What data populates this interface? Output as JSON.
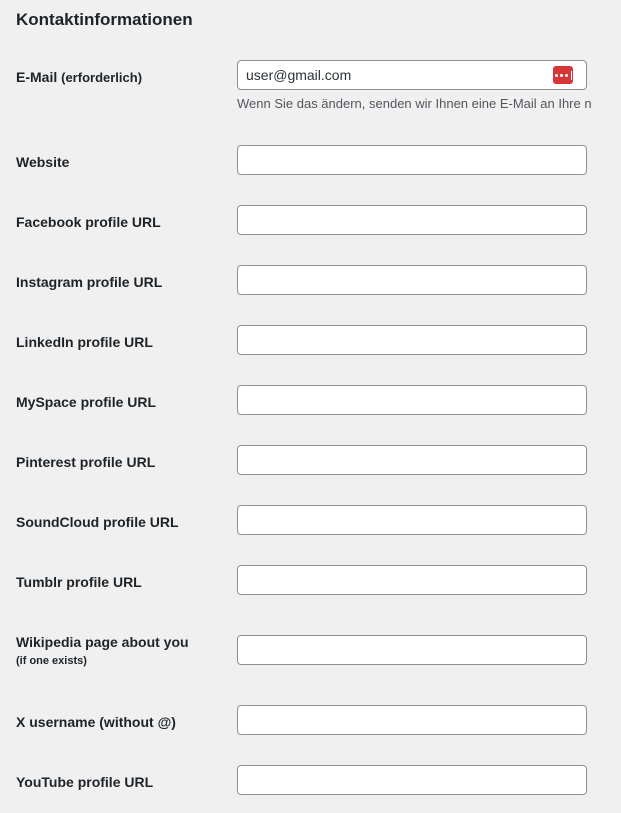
{
  "section": {
    "title": "Kontaktinformationen"
  },
  "email": {
    "label": "E-Mail",
    "required_note": "(erforderlich)",
    "value": "user@gmail.com",
    "description": "Wenn Sie das ändern, senden wir Ihnen eine E-Mail an Ihre n",
    "icon": "password-manager-icon",
    "icon_color": "#d63638"
  },
  "fields": [
    {
      "label": "Website",
      "value": ""
    },
    {
      "label": "Facebook profile URL",
      "value": ""
    },
    {
      "label": "Instagram profile URL",
      "value": ""
    },
    {
      "label": "LinkedIn profile URL",
      "value": ""
    },
    {
      "label": "MySpace profile URL",
      "value": ""
    },
    {
      "label": "Pinterest profile URL",
      "value": ""
    },
    {
      "label": "SoundCloud profile URL",
      "value": ""
    },
    {
      "label": "Tumblr profile URL",
      "value": ""
    },
    {
      "label": "Wikipedia page about you",
      "note": "(if one exists)",
      "value": ""
    },
    {
      "label": "X username (without @)",
      "value": ""
    },
    {
      "label": "YouTube profile URL",
      "value": ""
    }
  ]
}
